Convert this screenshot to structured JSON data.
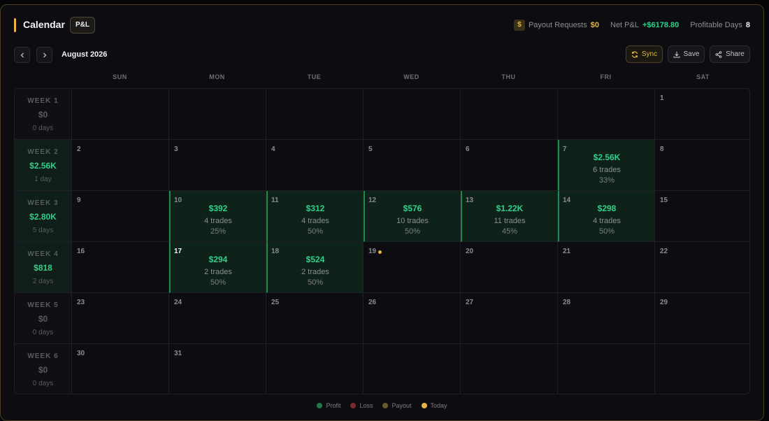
{
  "header": {
    "title": "Calendar",
    "mode_badge": "P&L",
    "payout_icon": "$",
    "payout_label": "Payout Requests",
    "payout_value": "$0",
    "net_label": "Net P&L",
    "net_value": "+$6178.80",
    "profitable_label": "Profitable Days",
    "profitable_value": "8"
  },
  "toolbar": {
    "month_label": "August 2026",
    "sync_label": "Sync",
    "save_label": "Save",
    "share_label": "Share"
  },
  "day_names": [
    "SUN",
    "MON",
    "TUE",
    "WED",
    "THU",
    "FRI",
    "SAT"
  ],
  "weeks": [
    {
      "label": "WEEK 1",
      "amount": "$0",
      "days": "0 days",
      "positive": false
    },
    {
      "label": "WEEK 2",
      "amount": "$2.56K",
      "days": "1 day",
      "positive": true
    },
    {
      "label": "WEEK 3",
      "amount": "$2.80K",
      "days": "5 days",
      "positive": true
    },
    {
      "label": "WEEK 4",
      "amount": "$818",
      "days": "2 days",
      "positive": true
    },
    {
      "label": "WEEK 5",
      "amount": "$0",
      "days": "0 days",
      "positive": false
    },
    {
      "label": "WEEK 6",
      "amount": "$0",
      "days": "0 days",
      "positive": false
    }
  ],
  "days": [
    {
      "date": "1",
      "row": 0,
      "col": 6
    },
    {
      "date": "2",
      "row": 1,
      "col": 0
    },
    {
      "date": "3",
      "row": 1,
      "col": 1
    },
    {
      "date": "4",
      "row": 1,
      "col": 2
    },
    {
      "date": "5",
      "row": 1,
      "col": 3
    },
    {
      "date": "6",
      "row": 1,
      "col": 4
    },
    {
      "date": "7",
      "row": 1,
      "col": 5,
      "amount": "$2.56K",
      "trades": "6 trades",
      "pct": "33%"
    },
    {
      "date": "8",
      "row": 1,
      "col": 6
    },
    {
      "date": "9",
      "row": 2,
      "col": 0
    },
    {
      "date": "10",
      "row": 2,
      "col": 1,
      "amount": "$392",
      "trades": "4 trades",
      "pct": "25%"
    },
    {
      "date": "11",
      "row": 2,
      "col": 2,
      "amount": "$312",
      "trades": "4 trades",
      "pct": "50%"
    },
    {
      "date": "12",
      "row": 2,
      "col": 3,
      "amount": "$576",
      "trades": "10 trades",
      "pct": "50%"
    },
    {
      "date": "13",
      "row": 2,
      "col": 4,
      "amount": "$1.22K",
      "trades": "11 trades",
      "pct": "45%"
    },
    {
      "date": "14",
      "row": 2,
      "col": 5,
      "amount": "$298",
      "trades": "4 trades",
      "pct": "50%"
    },
    {
      "date": "15",
      "row": 2,
      "col": 6
    },
    {
      "date": "16",
      "row": 3,
      "col": 0
    },
    {
      "date": "17",
      "row": 3,
      "col": 1,
      "amount": "$294",
      "trades": "2 trades",
      "pct": "50%",
      "bright": true
    },
    {
      "date": "18",
      "row": 3,
      "col": 2,
      "amount": "$524",
      "trades": "2 trades",
      "pct": "50%"
    },
    {
      "date": "19",
      "row": 3,
      "col": 3,
      "today": true
    },
    {
      "date": "20",
      "row": 3,
      "col": 4
    },
    {
      "date": "21",
      "row": 3,
      "col": 5
    },
    {
      "date": "22",
      "row": 3,
      "col": 6
    },
    {
      "date": "23",
      "row": 4,
      "col": 0
    },
    {
      "date": "24",
      "row": 4,
      "col": 1
    },
    {
      "date": "25",
      "row": 4,
      "col": 2
    },
    {
      "date": "26",
      "row": 4,
      "col": 3
    },
    {
      "date": "27",
      "row": 4,
      "col": 4
    },
    {
      "date": "28",
      "row": 4,
      "col": 5
    },
    {
      "date": "29",
      "row": 4,
      "col": 6
    },
    {
      "date": "30",
      "row": 5,
      "col": 0
    },
    {
      "date": "31",
      "row": 5,
      "col": 1
    }
  ],
  "legend": [
    {
      "label": "Profit",
      "color": "#1f7a45"
    },
    {
      "label": "Loss",
      "color": "#7a2a2a"
    },
    {
      "label": "Payout",
      "color": "#6b5a2a"
    },
    {
      "label": "Today",
      "color": "#e5b53d"
    }
  ],
  "icons": {
    "prev": "chevron-left-icon",
    "next": "chevron-right-icon",
    "sync": "sync-icon",
    "save": "download-icon",
    "share": "share-icon"
  }
}
